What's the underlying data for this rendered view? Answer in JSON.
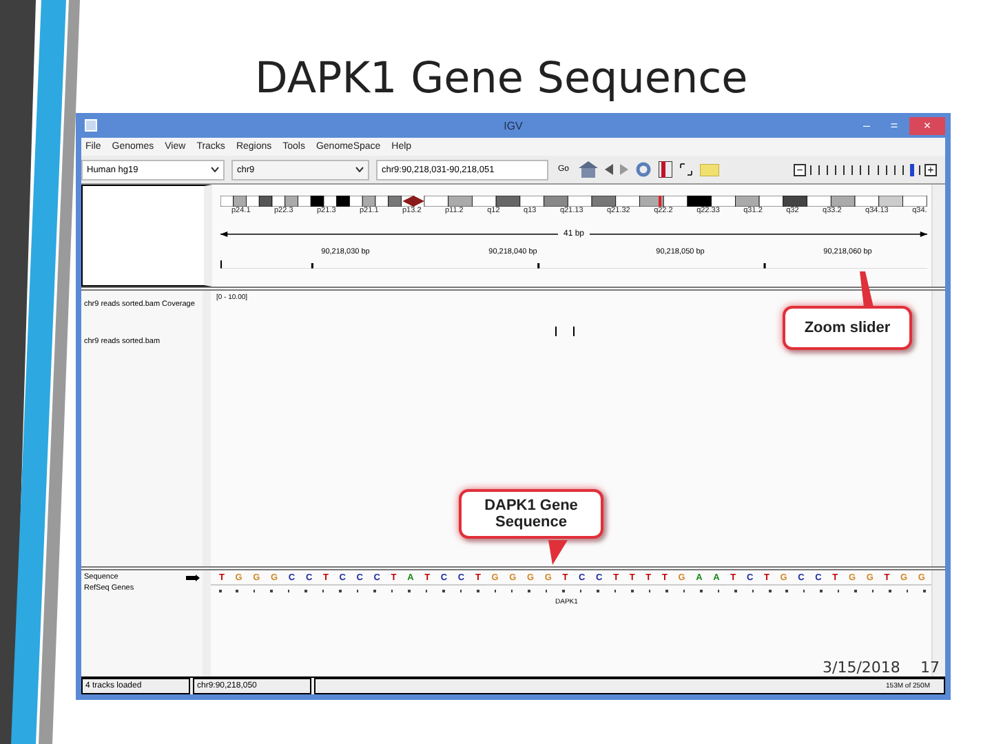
{
  "slide": {
    "title": "DAPK1 Gene Sequence",
    "date": "3/15/2018",
    "page_number": "17"
  },
  "window": {
    "title": "IGV",
    "controls": [
      "–",
      "=",
      "×"
    ]
  },
  "menu": [
    "File",
    "Genomes",
    "View",
    "Tracks",
    "Regions",
    "Tools",
    "GenomeSpace",
    "Help"
  ],
  "toolbar": {
    "genome": "Human hg19",
    "chromosome": "chr9",
    "locus": "chr9:90,218,031-90,218,051",
    "go": "Go",
    "zoom_out": "−",
    "zoom_in": "+",
    "zoom": {
      "level": 0.92
    }
  },
  "ideogram": {
    "bands": [
      "p24.1",
      "p22.3",
      "p21.3",
      "p21.1",
      "p13.2",
      "p11.2",
      "q12",
      "q13",
      "q21.13",
      "q21.32",
      "q22.2",
      "q22.33",
      "q31.2",
      "q32",
      "q33.2",
      "q34.13",
      "q34."
    ],
    "region": {
      "level": 0.62
    }
  },
  "ruler": {
    "span": "41 bp",
    "ticks": [
      "90,218,030 bp",
      "90,218,040 bp",
      "90,218,050 bp",
      "90,218,060 bp"
    ]
  },
  "data_tracks": [
    {
      "name": "chr9 reads sorted.bam Coverage",
      "range": "[0 - 10.00]"
    },
    {
      "name": "chr9 reads sorted.bam"
    }
  ],
  "feature_tracks": [
    {
      "name": "Sequence",
      "kind": "sequence"
    },
    {
      "name": "RefSeq Genes",
      "kind": "genes",
      "gene": "DAPK1"
    }
  ],
  "sequence": [
    {
      "base": "T",
      "color": "#c00000"
    },
    {
      "base": "G",
      "color": "#d1892a"
    },
    {
      "base": "G",
      "color": "#d1892a"
    },
    {
      "base": "G",
      "color": "#d1892a"
    },
    {
      "base": "C",
      "color": "#1f2fa0"
    },
    {
      "base": "C",
      "color": "#1f2fa0"
    },
    {
      "base": "T",
      "color": "#c00000"
    },
    {
      "base": "C",
      "color": "#1f2fa0"
    },
    {
      "base": "C",
      "color": "#1f2fa0"
    },
    {
      "base": "C",
      "color": "#1f2fa0"
    },
    {
      "base": "T",
      "color": "#c00000"
    },
    {
      "base": "A",
      "color": "#1a8a1a"
    },
    {
      "base": "T",
      "color": "#c00000"
    },
    {
      "base": "C",
      "color": "#1f2fa0"
    },
    {
      "base": "C",
      "color": "#1f2fa0"
    },
    {
      "base": "T",
      "color": "#c00000"
    },
    {
      "base": "G",
      "color": "#d1892a"
    },
    {
      "base": "G",
      "color": "#d1892a"
    },
    {
      "base": "G",
      "color": "#d1892a"
    },
    {
      "base": "G",
      "color": "#d1892a"
    },
    {
      "base": "T",
      "color": "#c00000"
    },
    {
      "base": "C",
      "color": "#1f2fa0"
    },
    {
      "base": "C",
      "color": "#1f2fa0"
    },
    {
      "base": "T",
      "color": "#c00000"
    },
    {
      "base": "T",
      "color": "#c00000"
    },
    {
      "base": "T",
      "color": "#c00000"
    },
    {
      "base": "T",
      "color": "#c00000"
    },
    {
      "base": "G",
      "color": "#d1892a"
    },
    {
      "base": "A",
      "color": "#1a8a1a"
    },
    {
      "base": "A",
      "color": "#1a8a1a"
    },
    {
      "base": "T",
      "color": "#c00000"
    },
    {
      "base": "C",
      "color": "#1f2fa0"
    },
    {
      "base": "T",
      "color": "#c00000"
    },
    {
      "base": "G",
      "color": "#d1892a"
    },
    {
      "base": "C",
      "color": "#1f2fa0"
    },
    {
      "base": "C",
      "color": "#1f2fa0"
    },
    {
      "base": "T",
      "color": "#c00000"
    },
    {
      "base": "G",
      "color": "#d1892a"
    },
    {
      "base": "G",
      "color": "#d1892a"
    },
    {
      "base": "T",
      "color": "#c00000"
    },
    {
      "base": "G",
      "color": "#d1892a"
    },
    {
      "base": "G",
      "color": "#d1892a"
    }
  ],
  "status_bar": {
    "message": "4 tracks loaded",
    "position": "chr9:90,218,050",
    "memory": "153M of 250M"
  },
  "callouts": [
    {
      "kind": "zoom",
      "text": "Zoom slider"
    },
    {
      "kind": "gene",
      "text": "DAPK1 Gene Sequence"
    }
  ]
}
